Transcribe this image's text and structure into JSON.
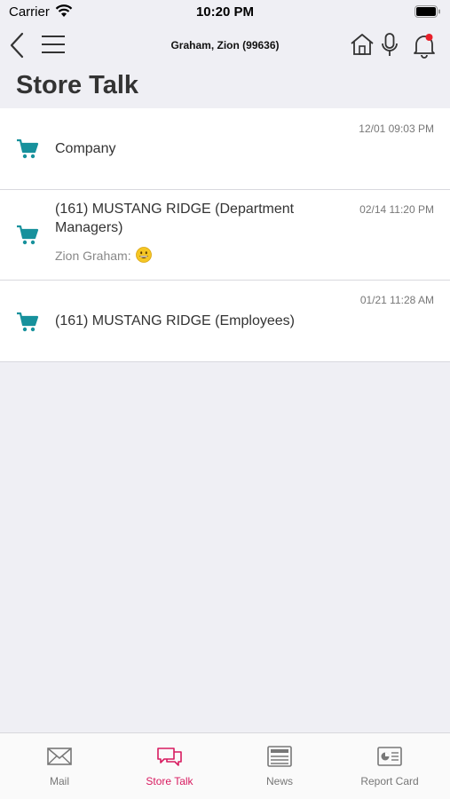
{
  "status_bar": {
    "carrier": "Carrier",
    "time": "10:20 PM"
  },
  "header": {
    "user": "Graham, Zion (99636)"
  },
  "page": {
    "title": "Store Talk"
  },
  "colors": {
    "accent": "#d81b60",
    "cart": "#17919c",
    "notification_dot": "#e8202a"
  },
  "conversations": [
    {
      "title": "Company",
      "time": "12/01 09:03 PM",
      "preview": "",
      "icon": "cart-icon"
    },
    {
      "title": "(161) MUSTANG RIDGE (Department Managers)",
      "time": "02/14 11:20 PM",
      "preview": "Zion Graham:",
      "icon": "cart-icon"
    },
    {
      "title": "(161) MUSTANG RIDGE (Employees)",
      "time": "01/21 11:28 AM",
      "preview": "",
      "icon": "cart-icon"
    }
  ],
  "tabs": [
    {
      "label": "Mail",
      "icon": "mail-icon",
      "active": false
    },
    {
      "label": "Store Talk",
      "icon": "chat-bubbles-icon",
      "active": true
    },
    {
      "label": "News",
      "icon": "newspaper-icon",
      "active": false
    },
    {
      "label": "Report Card",
      "icon": "report-card-icon",
      "active": false
    }
  ]
}
